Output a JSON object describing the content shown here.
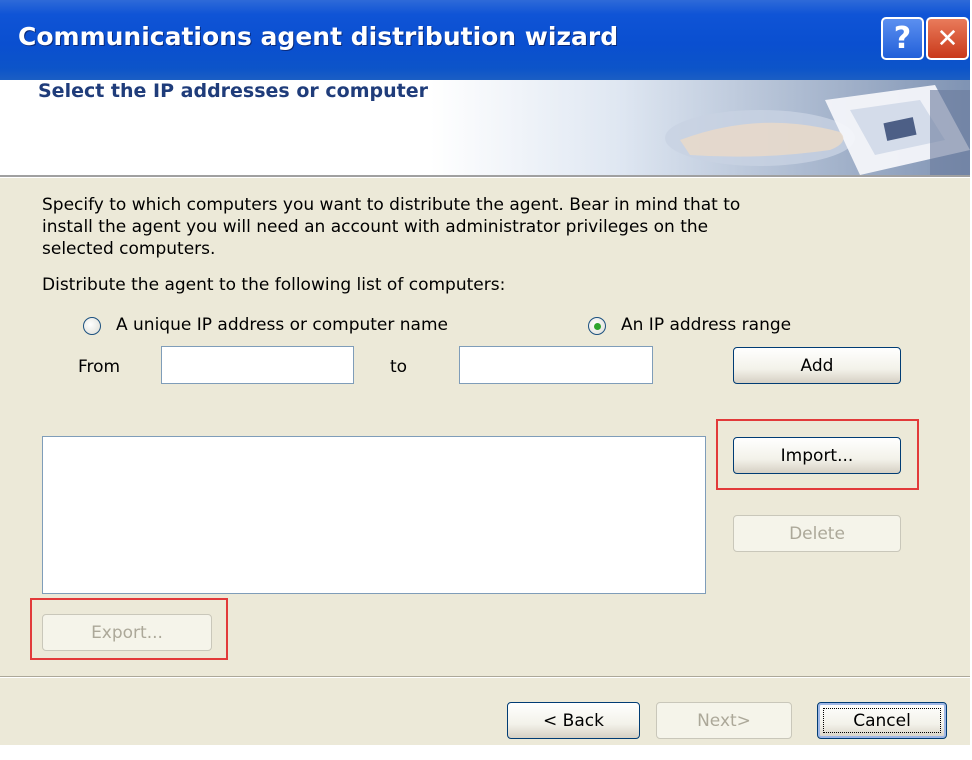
{
  "window": {
    "title": "Communications agent distribution wizard",
    "help_label": "?",
    "close_label": "✕"
  },
  "header": {
    "title": "Select the IP addresses or computer names."
  },
  "body": {
    "description_line1": "Specify to which computers you want to distribute the agent.  Bear in mind that to",
    "description_line2": "install the agent you will need an account with administrator privileges on the",
    "description_line3": "selected computers.",
    "list_label": "Distribute the agent to the following list of computers:"
  },
  "options": {
    "unique_label": "A unique IP address or computer name",
    "unique_selected": false,
    "range_label": "An IP address range",
    "range_selected": true
  },
  "range": {
    "from_label": "From",
    "from_value": "",
    "to_label": "to",
    "to_value": ""
  },
  "buttons": {
    "add": "Add",
    "import": "Import...",
    "delete": "Delete",
    "export": "Export...",
    "back": "< Back",
    "next": "Next>",
    "cancel": "Cancel"
  },
  "computer_list": []
}
